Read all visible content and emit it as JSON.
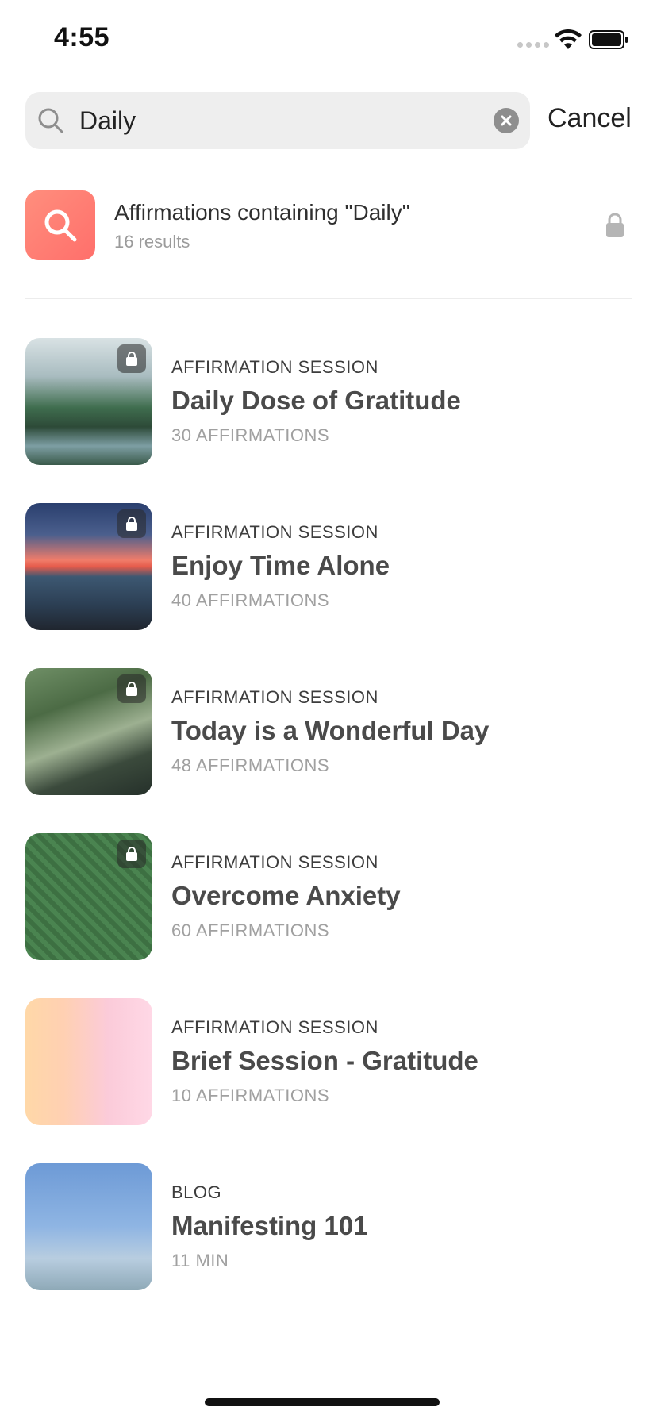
{
  "status_bar": {
    "time": "4:55"
  },
  "search": {
    "value": "Daily",
    "cancel_label": "Cancel"
  },
  "container_result": {
    "title": "Affirmations containing \"Daily\"",
    "subtitle": "16 results"
  },
  "results": [
    {
      "type": "AFFIRMATION SESSION",
      "title": "Daily Dose of Gratitude",
      "meta": "30 AFFIRMATIONS",
      "locked": true
    },
    {
      "type": "AFFIRMATION SESSION",
      "title": "Enjoy Time Alone",
      "meta": "40 AFFIRMATIONS",
      "locked": true
    },
    {
      "type": "AFFIRMATION SESSION",
      "title": "Today is a Wonderful Day",
      "meta": "48 AFFIRMATIONS",
      "locked": true
    },
    {
      "type": "AFFIRMATION SESSION",
      "title": "Overcome Anxiety",
      "meta": "60 AFFIRMATIONS",
      "locked": true
    },
    {
      "type": "AFFIRMATION SESSION",
      "title": "Brief Session - Gratitude",
      "meta": "10 AFFIRMATIONS",
      "locked": false
    },
    {
      "type": "BLOG",
      "title": "Manifesting 101",
      "meta": "11 MIN",
      "locked": false
    }
  ],
  "colors": {
    "accent": "#ff7b72",
    "muted": "#a0a0a0"
  }
}
